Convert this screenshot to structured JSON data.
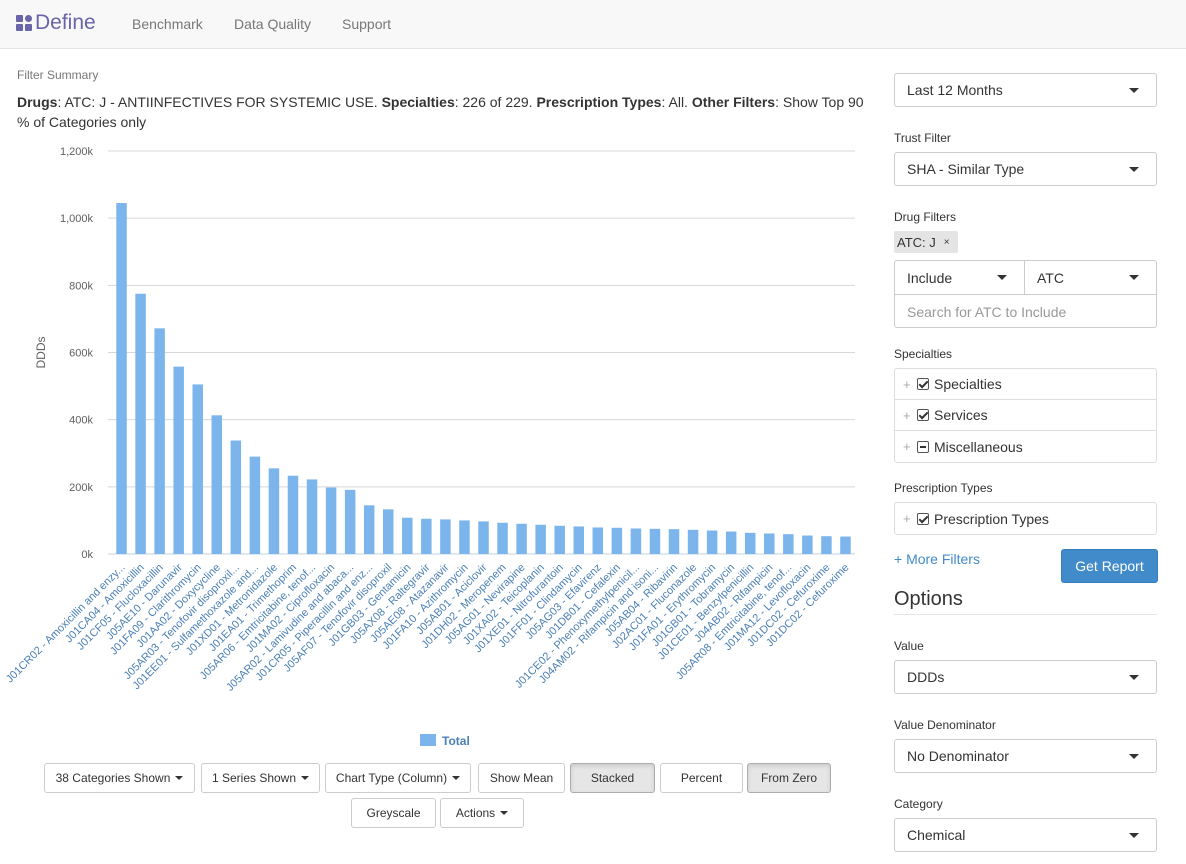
{
  "nav": {
    "brand": "Define",
    "links": [
      "Benchmark",
      "Data Quality",
      "Support"
    ]
  },
  "filter": {
    "title": "Filter Summary",
    "drugs_label": "Drugs",
    "drugs_value": ": ATC: J - ANTIINFECTIVES FOR SYSTEMIC USE. ",
    "specialties_label": "Specialties",
    "specialties_value": ": 226 of 229. ",
    "ptypes_label": "Prescription Types",
    "ptypes_value": ": All. ",
    "other_label": "Other Filters",
    "other_value": ": Show Top 90 % of Categories only"
  },
  "chart_data": {
    "type": "bar",
    "ylabel": "DDDs",
    "ylim": [
      0,
      1200000
    ],
    "yticks": [
      "0k",
      "200k",
      "400k",
      "600k",
      "800k",
      "1,000k",
      "1,200k"
    ],
    "grid": true,
    "legend": "bottom",
    "series": [
      {
        "name": "Total",
        "color": "#7cb5ec",
        "values": [
          1045000,
          775000,
          672000,
          558000,
          505000,
          413000,
          338000,
          290000,
          255000,
          233000,
          222000,
          198000,
          191000,
          145000,
          133000,
          108000,
          105000,
          103000,
          100000,
          97000,
          93000,
          90000,
          87000,
          84000,
          82000,
          79000,
          78000,
          76000,
          75000,
          74000,
          72000,
          70000,
          67000,
          63000,
          61000,
          59000,
          55000,
          53000,
          52000
        ]
      }
    ],
    "categories": [
      "J01CR02 - Amoxicillin and enzy...",
      "J01CA04 - Amoxicillin",
      "J01CF05 - Flucloxacillin",
      "J05AE10 - Darunavir",
      "J01FA09 - Clarithromycin",
      "J01AA02 - Doxycycline",
      "J05AR03 - Tenofovir disoproxil...",
      "J01EE01 - Sulfamethoxazole and...",
      "J01XD01 - Metronidazole",
      "J01EA01 - Trimethoprim",
      "J05AR06 - Emtricitabine, tenof...",
      "J01MA02 - Ciprofloxacin",
      "J05AR02 - Lamivudine and abaca...",
      "J01CR05 - Piperacillin and enz...",
      "J05AF07 - Tenofovir disoproxil",
      "J01GB03 - Gentamicin",
      "J05AX08 - Raltegravir",
      "J05AE08 - Atazanavir",
      "J01FA10 - Azithromycin",
      "J05AB01 - Aciclovir",
      "J01DH02 - Meropenem",
      "J05AG01 - Nevirapine",
      "J01XA02 - Teicoplanin",
      "J01XE01 - Nitrofurantoin",
      "J01FF01 - Clindamycin",
      "J05AG03 - Efavirenz",
      "J01DB01 - Cefalexin",
      "J01CE02 - Phenoxymethylpenicil...",
      "J04AM02 - Rifampicin and isoni...",
      "J05AB04 - Ribavirin",
      "J02AC01 - Fluconazole",
      "J01FA01 - Erythromycin",
      "J01GB01 - Tobramycin",
      "J01CE01 - Benzylpenicillin",
      "J04AB02 - Rifampicin",
      "J05AR08 - Emtricitabine, tenof...",
      "J01MA12 - Levofloxacin",
      "J01DC02 - Cefuroxime",
      "J01DC02 - Cefuroxime"
    ]
  },
  "controls": {
    "categories_shown": "38 Categories Shown",
    "series_shown": "1 Series Shown",
    "chart_type": "Chart Type (Column)",
    "show_mean": "Show Mean",
    "stacked": "Stacked",
    "percent": "Percent",
    "from_zero": "From Zero",
    "greyscale": "Greyscale",
    "actions": "Actions"
  },
  "panel": {
    "period": "Last 12 Months",
    "trust_filter_label": "Trust Filter",
    "trust_filter": "SHA - Similar Type",
    "drug_filters_label": "Drug Filters",
    "drug_chip": "ATC: J",
    "drug_chip_remove": "×",
    "include": "Include",
    "atc": "ATC",
    "atc_search_placeholder": "Search for ATC to Include",
    "specialties_label": "Specialties",
    "specialties_tree": [
      "Specialties",
      "Services",
      "Miscellaneous"
    ],
    "ptypes_label": "Prescription Types",
    "ptypes_tree": [
      "Prescription Types"
    ],
    "more_filters": "+ More Filters",
    "get_report": "Get Report",
    "options_title": "Options",
    "value_label": "Value",
    "value": "DDDs",
    "value_denominator_label": "Value Denominator",
    "value_denominator": "No Denominator",
    "category_label": "Category",
    "category": "Chemical"
  }
}
